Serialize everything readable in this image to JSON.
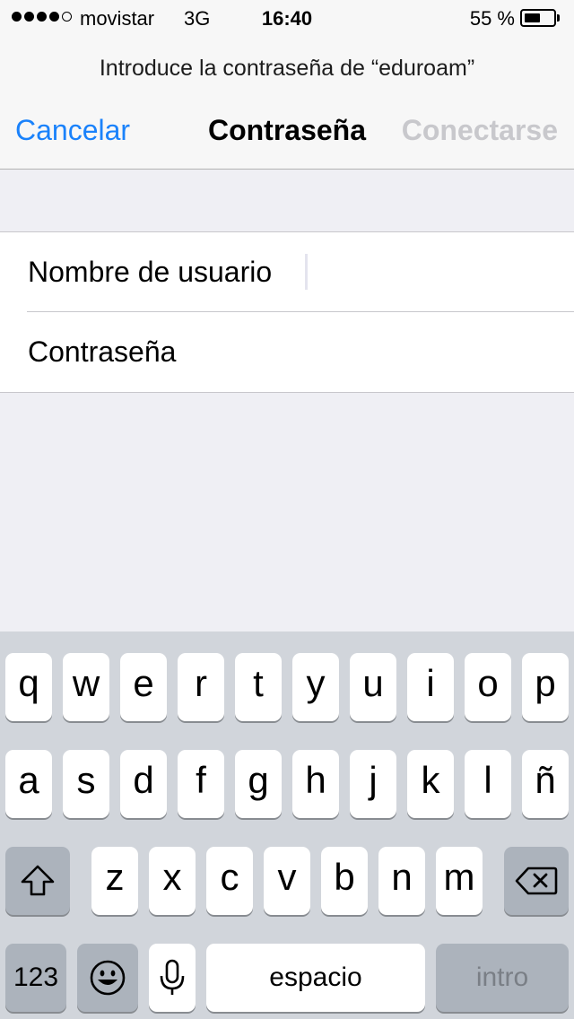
{
  "status_bar": {
    "carrier": "movistar",
    "network": "3G",
    "time": "16:40",
    "battery_percent": "55 %",
    "battery_level": 0.55,
    "signal_bars_filled": 4,
    "signal_bars_total": 5
  },
  "header": {
    "prompt": "Introduce la contraseña de “eduroam”",
    "cancel_label": "Cancelar",
    "title": "Contraseña",
    "connect_label": "Conectarse"
  },
  "form": {
    "username_label": "Nombre de usuario",
    "username_value": "",
    "password_label": "Contraseña",
    "password_value": ""
  },
  "keyboard": {
    "rows": [
      [
        "q",
        "w",
        "e",
        "r",
        "t",
        "y",
        "u",
        "i",
        "o",
        "p"
      ],
      [
        "a",
        "s",
        "d",
        "f",
        "g",
        "h",
        "j",
        "k",
        "l",
        "ñ"
      ],
      [
        "z",
        "x",
        "c",
        "v",
        "b",
        "n",
        "m"
      ]
    ],
    "numbers_label": "123",
    "space_label": "espacio",
    "return_label": "intro"
  },
  "colors": {
    "accent": "#1a82fb",
    "disabled": "#c8c8cc",
    "keyboard_bg": "#d1d5db",
    "key_dark": "#acb3bc"
  }
}
